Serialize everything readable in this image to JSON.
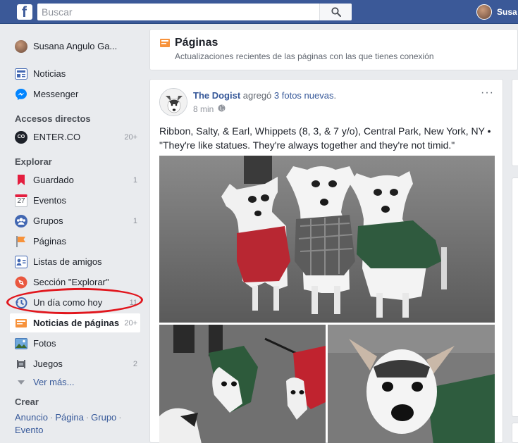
{
  "topbar": {
    "search_placeholder": "Buscar",
    "user_name": "Susa",
    "brand_color": "#3b5998"
  },
  "sidebar": {
    "profile": {
      "name": "Susana Angulo Ga..."
    },
    "main": [
      {
        "label": "Noticias",
        "icon": "news-feed-icon"
      },
      {
        "label": "Messenger",
        "icon": "messenger-icon"
      }
    ],
    "shortcuts_title": "Accesos directos",
    "shortcuts": [
      {
        "label": "ENTER.CO",
        "count": "20+",
        "icon": "enterco-icon"
      }
    ],
    "explore_title": "Explorar",
    "explore": [
      {
        "label": "Guardado",
        "count": "1",
        "icon": "bookmark-icon"
      },
      {
        "label": "Eventos",
        "count": "",
        "icon": "calendar-icon",
        "icon_text": "27"
      },
      {
        "label": "Grupos",
        "count": "1",
        "icon": "groups-icon"
      },
      {
        "label": "Páginas",
        "count": "",
        "icon": "pages-flag-icon"
      },
      {
        "label": "Listas de amigos",
        "count": "",
        "icon": "friend-lists-icon"
      },
      {
        "label": "Sección \"Explorar\"",
        "count": "",
        "icon": "explore-icon"
      },
      {
        "label": "Un día como hoy",
        "count": "11",
        "icon": "memories-icon"
      },
      {
        "label": "Noticias de páginas",
        "count": "20+",
        "icon": "pages-feed-icon",
        "active": true
      },
      {
        "label": "Fotos",
        "count": "",
        "icon": "photos-icon"
      },
      {
        "label": "Juegos",
        "count": "2",
        "icon": "games-icon"
      }
    ],
    "see_more": "Ver más...",
    "create_title": "Crear",
    "create_links": [
      "Anuncio",
      "Página",
      "Grupo",
      "Evento"
    ]
  },
  "page_header": {
    "title": "Páginas",
    "subtitle": "Actualizaciones recientes de las páginas con las que tienes conexión"
  },
  "post": {
    "author": "The Dogist",
    "action": "agregó",
    "action_link": "3 fotos nuevas",
    "action_end": ".",
    "time": "8 min",
    "more": "···",
    "text": "Ribbon, Salty, & Earl, Whippets (8, 3, & 7 y/o), Central Park, New York, NY • \"They're like statues. They're always together and they're not timid.\""
  },
  "colors": {
    "link": "#365899",
    "background": "#e9ebee",
    "annotation_red": "#e1161d"
  }
}
